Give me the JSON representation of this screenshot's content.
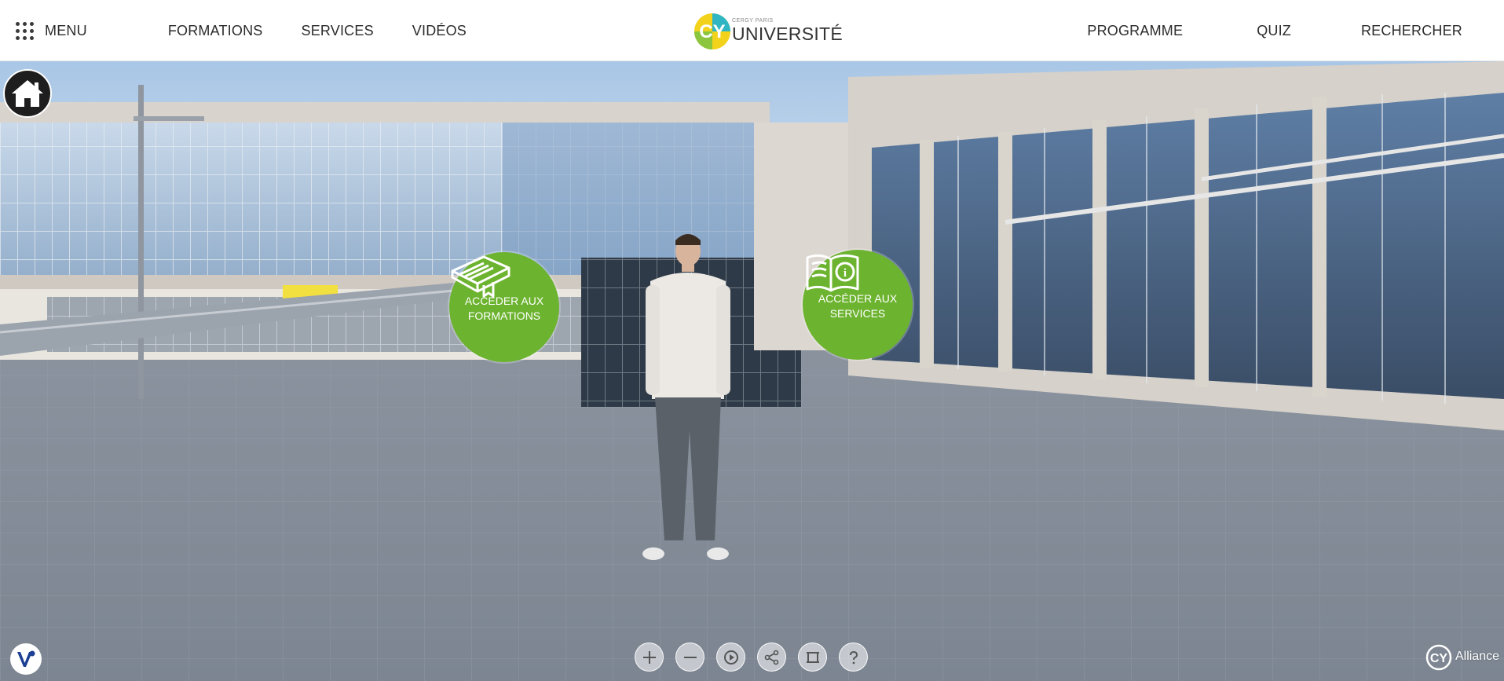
{
  "nav": {
    "menu_label": "MENU",
    "left_links": [
      "FORMATIONS",
      "SERVICES",
      "VIDÉOS"
    ],
    "right_links": [
      "PROGRAMME",
      "QUIZ",
      "RECHERCHER"
    ]
  },
  "logo": {
    "mark": "CY",
    "subtitle": "CERGY PARIS",
    "title": "UNIVERSITÉ"
  },
  "hotspots": {
    "formations": {
      "line1": "ACCÉDER AUX",
      "line2": "FORMATIONS",
      "icon": "book-icon"
    },
    "services": {
      "line1": "ACCÉDER AUX",
      "line2": "SERVICES",
      "icon": "info-book-icon"
    }
  },
  "controls": [
    "zoom-in-icon",
    "zoom-out-icon",
    "autoplay-icon",
    "share-icon",
    "fullscreen-icon",
    "help-icon"
  ],
  "footer": {
    "alliance_label": "Alliance",
    "alliance_mark": "CY"
  },
  "colors": {
    "accent_green": "#6cb32f",
    "logo_yellow": "#f2d21b",
    "logo_teal": "#2fb6c2",
    "logo_green": "#8cc63f",
    "nav_text": "#2b2b2b"
  }
}
